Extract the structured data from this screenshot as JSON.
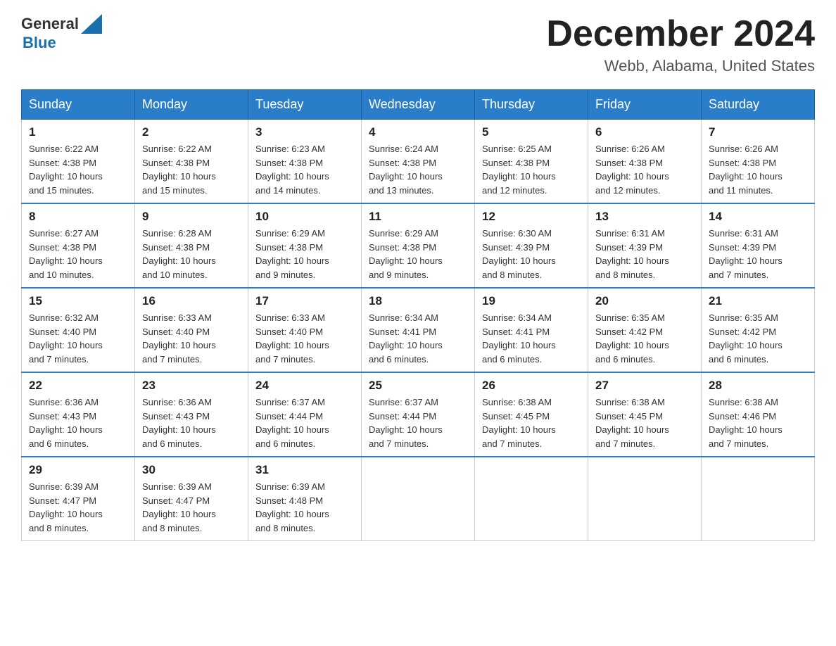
{
  "header": {
    "logo": {
      "text_general": "General",
      "text_blue": "Blue",
      "icon_alt": "GeneralBlue logo"
    },
    "title": "December 2024",
    "location": "Webb, Alabama, United States"
  },
  "calendar": {
    "days_of_week": [
      "Sunday",
      "Monday",
      "Tuesday",
      "Wednesday",
      "Thursday",
      "Friday",
      "Saturday"
    ],
    "weeks": [
      [
        {
          "day": "1",
          "sunrise": "6:22 AM",
          "sunset": "4:38 PM",
          "daylight": "10 hours and 15 minutes."
        },
        {
          "day": "2",
          "sunrise": "6:22 AM",
          "sunset": "4:38 PM",
          "daylight": "10 hours and 15 minutes."
        },
        {
          "day": "3",
          "sunrise": "6:23 AM",
          "sunset": "4:38 PM",
          "daylight": "10 hours and 14 minutes."
        },
        {
          "day": "4",
          "sunrise": "6:24 AM",
          "sunset": "4:38 PM",
          "daylight": "10 hours and 13 minutes."
        },
        {
          "day": "5",
          "sunrise": "6:25 AM",
          "sunset": "4:38 PM",
          "daylight": "10 hours and 12 minutes."
        },
        {
          "day": "6",
          "sunrise": "6:26 AM",
          "sunset": "4:38 PM",
          "daylight": "10 hours and 12 minutes."
        },
        {
          "day": "7",
          "sunrise": "6:26 AM",
          "sunset": "4:38 PM",
          "daylight": "10 hours and 11 minutes."
        }
      ],
      [
        {
          "day": "8",
          "sunrise": "6:27 AM",
          "sunset": "4:38 PM",
          "daylight": "10 hours and 10 minutes."
        },
        {
          "day": "9",
          "sunrise": "6:28 AM",
          "sunset": "4:38 PM",
          "daylight": "10 hours and 10 minutes."
        },
        {
          "day": "10",
          "sunrise": "6:29 AM",
          "sunset": "4:38 PM",
          "daylight": "10 hours and 9 minutes."
        },
        {
          "day": "11",
          "sunrise": "6:29 AM",
          "sunset": "4:38 PM",
          "daylight": "10 hours and 9 minutes."
        },
        {
          "day": "12",
          "sunrise": "6:30 AM",
          "sunset": "4:39 PM",
          "daylight": "10 hours and 8 minutes."
        },
        {
          "day": "13",
          "sunrise": "6:31 AM",
          "sunset": "4:39 PM",
          "daylight": "10 hours and 8 minutes."
        },
        {
          "day": "14",
          "sunrise": "6:31 AM",
          "sunset": "4:39 PM",
          "daylight": "10 hours and 7 minutes."
        }
      ],
      [
        {
          "day": "15",
          "sunrise": "6:32 AM",
          "sunset": "4:40 PM",
          "daylight": "10 hours and 7 minutes."
        },
        {
          "day": "16",
          "sunrise": "6:33 AM",
          "sunset": "4:40 PM",
          "daylight": "10 hours and 7 minutes."
        },
        {
          "day": "17",
          "sunrise": "6:33 AM",
          "sunset": "4:40 PM",
          "daylight": "10 hours and 7 minutes."
        },
        {
          "day": "18",
          "sunrise": "6:34 AM",
          "sunset": "4:41 PM",
          "daylight": "10 hours and 6 minutes."
        },
        {
          "day": "19",
          "sunrise": "6:34 AM",
          "sunset": "4:41 PM",
          "daylight": "10 hours and 6 minutes."
        },
        {
          "day": "20",
          "sunrise": "6:35 AM",
          "sunset": "4:42 PM",
          "daylight": "10 hours and 6 minutes."
        },
        {
          "day": "21",
          "sunrise": "6:35 AM",
          "sunset": "4:42 PM",
          "daylight": "10 hours and 6 minutes."
        }
      ],
      [
        {
          "day": "22",
          "sunrise": "6:36 AM",
          "sunset": "4:43 PM",
          "daylight": "10 hours and 6 minutes."
        },
        {
          "day": "23",
          "sunrise": "6:36 AM",
          "sunset": "4:43 PM",
          "daylight": "10 hours and 6 minutes."
        },
        {
          "day": "24",
          "sunrise": "6:37 AM",
          "sunset": "4:44 PM",
          "daylight": "10 hours and 6 minutes."
        },
        {
          "day": "25",
          "sunrise": "6:37 AM",
          "sunset": "4:44 PM",
          "daylight": "10 hours and 7 minutes."
        },
        {
          "day": "26",
          "sunrise": "6:38 AM",
          "sunset": "4:45 PM",
          "daylight": "10 hours and 7 minutes."
        },
        {
          "day": "27",
          "sunrise": "6:38 AM",
          "sunset": "4:45 PM",
          "daylight": "10 hours and 7 minutes."
        },
        {
          "day": "28",
          "sunrise": "6:38 AM",
          "sunset": "4:46 PM",
          "daylight": "10 hours and 7 minutes."
        }
      ],
      [
        {
          "day": "29",
          "sunrise": "6:39 AM",
          "sunset": "4:47 PM",
          "daylight": "10 hours and 8 minutes."
        },
        {
          "day": "30",
          "sunrise": "6:39 AM",
          "sunset": "4:47 PM",
          "daylight": "10 hours and 8 minutes."
        },
        {
          "day": "31",
          "sunrise": "6:39 AM",
          "sunset": "4:48 PM",
          "daylight": "10 hours and 8 minutes."
        },
        null,
        null,
        null,
        null
      ]
    ],
    "labels": {
      "sunrise": "Sunrise:",
      "sunset": "Sunset:",
      "daylight": "Daylight:"
    }
  }
}
